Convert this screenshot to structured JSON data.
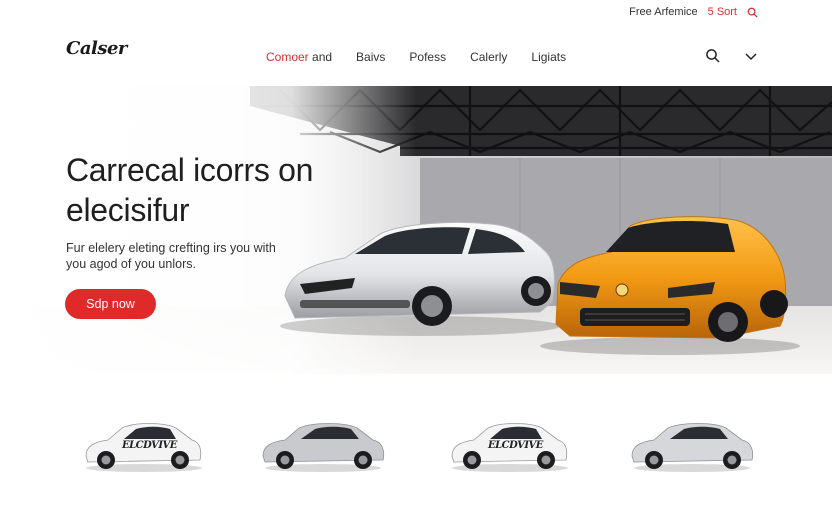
{
  "utility": {
    "link_label": "Free Arfemice",
    "sort_label": "5 Sort"
  },
  "header": {
    "logo": "Calser",
    "nav": [
      {
        "label_accent": "Comoer",
        "label_rest": " and"
      },
      {
        "label": "Baivs"
      },
      {
        "label": "Pofess"
      },
      {
        "label": "Calerly"
      },
      {
        "label": "Ligiats"
      }
    ],
    "icons": [
      "search-icon",
      "chevron-down-icon"
    ]
  },
  "hero": {
    "title": "Carrecal icorrs on elecisifur",
    "subtitle": "Fur elelery eleting crefting irs you with you agod of you unlors.",
    "cta_label": "Sdp now",
    "car_colors": {
      "left": "#e9eaec",
      "right": "#f0a01e"
    }
  },
  "thumbnails": [
    {
      "wrap_text": "ELCDVIVE"
    },
    {},
    {
      "wrap_text": "ELCDVIVE"
    },
    {}
  ],
  "colors": {
    "accent": "#e02a2a",
    "text": "#222222"
  }
}
